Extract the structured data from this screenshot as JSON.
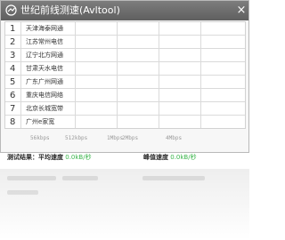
{
  "window": {
    "title": "世纪前线测速(Avltool)",
    "close_glyph": "×",
    "title_bar_color": "#6b6b6b"
  },
  "nodes": [
    {
      "index": "1",
      "name": "天津海泰网通"
    },
    {
      "index": "2",
      "name": "江苏常州电信"
    },
    {
      "index": "3",
      "name": "辽宁北方网通"
    },
    {
      "index": "4",
      "name": "甘肃天水电信"
    },
    {
      "index": "5",
      "name": "广东广州网通"
    },
    {
      "index": "6",
      "name": "重庆电信网络"
    },
    {
      "index": "7",
      "name": "北京长城宽带"
    },
    {
      "index": "8",
      "name": "广州e家宽"
    }
  ],
  "speed_scale": [
    "56kbps",
    "512kbps",
    "1Mbps",
    "2Mbps",
    "4Mbps"
  ],
  "status": {
    "result_label": "测试结果：平均速度",
    "avg_speed": "0.0kB/秒",
    "peak_label": "峰值速度",
    "peak_speed": "0.0kB/秒"
  },
  "colors": {
    "accent_green": "#39b54a",
    "grid_line": "#dadada"
  }
}
